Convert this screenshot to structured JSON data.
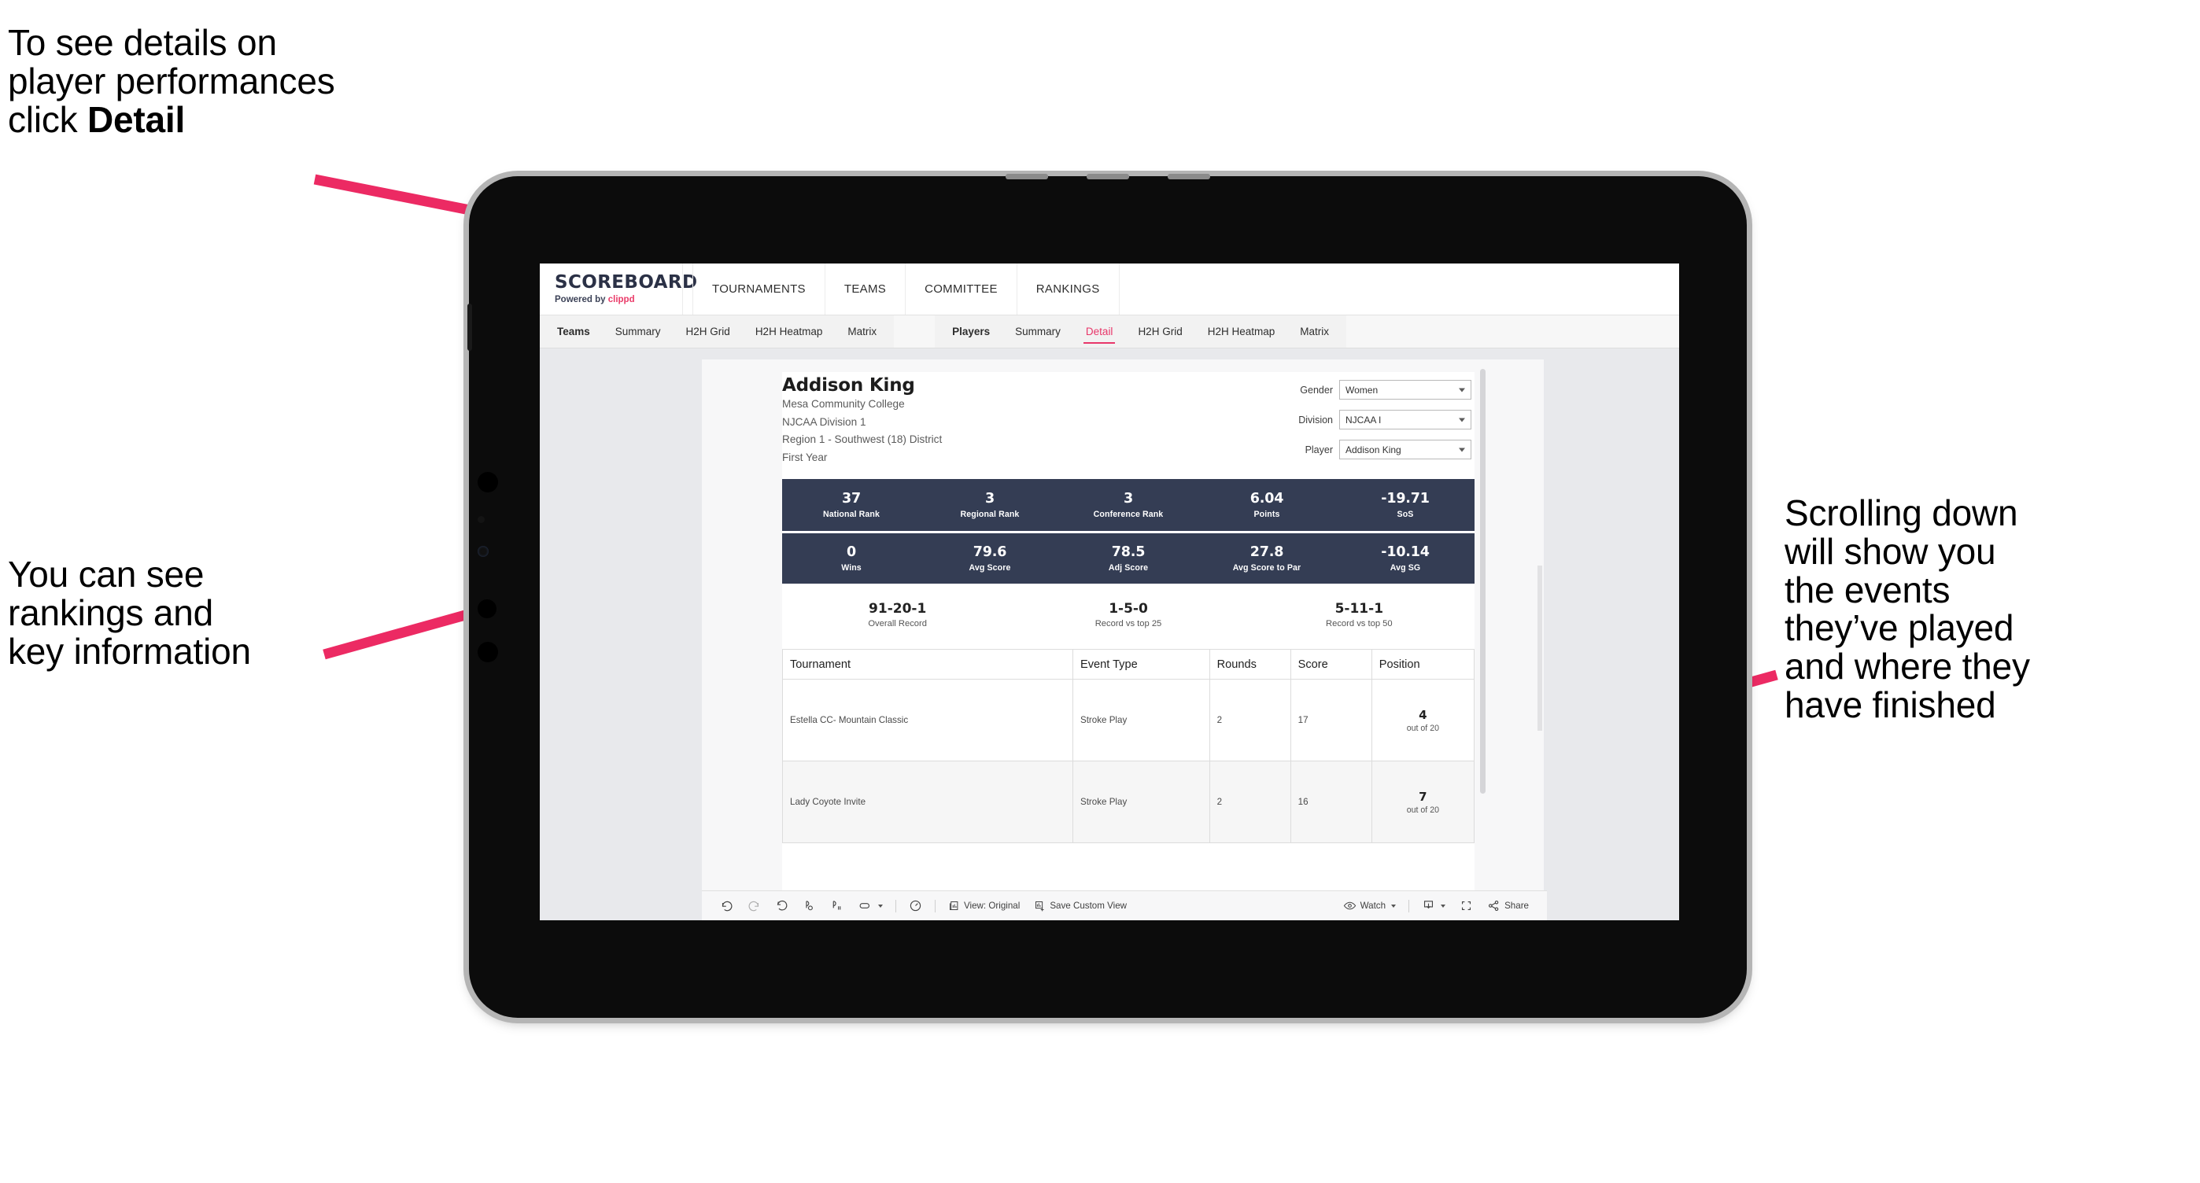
{
  "annotations": {
    "top_left": "To see details on\nplayer performances\nclick ",
    "top_left_bold": "Detail",
    "mid_left": "You can see\nrankings and\nkey information",
    "right": "Scrolling down\nwill show you\nthe events\nthey’ve played\nand where they\nhave finished"
  },
  "brand": {
    "name": "SCOREBOARD",
    "powered_prefix": "Powered by ",
    "powered_brand": "clippd",
    "accent_color": "#ea3a68"
  },
  "top_nav": [
    {
      "label": "TOURNAMENTS"
    },
    {
      "label": "TEAMS"
    },
    {
      "label": "COMMITTEE"
    },
    {
      "label": "RANKINGS"
    }
  ],
  "tabs": {
    "group_teams": [
      {
        "label": "Teams",
        "active": false
      },
      {
        "label": "Summary",
        "active": false
      },
      {
        "label": "H2H Grid",
        "active": false
      },
      {
        "label": "H2H Heatmap",
        "active": false
      },
      {
        "label": "Matrix",
        "active": false
      }
    ],
    "group_players": [
      {
        "label": "Players",
        "active": false
      },
      {
        "label": "Summary",
        "active": false
      },
      {
        "label": "Detail",
        "active": true
      },
      {
        "label": "H2H Grid",
        "active": false
      },
      {
        "label": "H2H Heatmap",
        "active": false
      },
      {
        "label": "Matrix",
        "active": false
      }
    ]
  },
  "player": {
    "name": "Addison King",
    "school": "Mesa Community College",
    "division": "NJCAA Division 1",
    "region": "Region 1 - Southwest (18) District",
    "year": "First Year"
  },
  "filters": [
    {
      "label": "Gender",
      "value": "Women"
    },
    {
      "label": "Division",
      "value": "NJCAA I"
    },
    {
      "label": "Player",
      "value": "Addison King"
    }
  ],
  "stats_band_1": [
    {
      "value": "37",
      "label": "National Rank"
    },
    {
      "value": "3",
      "label": "Regional Rank"
    },
    {
      "value": "3",
      "label": "Conference Rank"
    },
    {
      "value": "6.04",
      "label": "Points"
    },
    {
      "value": "-19.71",
      "label": "SoS"
    }
  ],
  "stats_band_2": [
    {
      "value": "0",
      "label": "Wins"
    },
    {
      "value": "79.6",
      "label": "Avg Score"
    },
    {
      "value": "78.5",
      "label": "Adj Score"
    },
    {
      "value": "27.8",
      "label": "Avg Score to Par"
    },
    {
      "value": "-10.14",
      "label": "Avg SG"
    }
  ],
  "records": [
    {
      "value": "91-20-1",
      "label": "Overall Record"
    },
    {
      "value": "1-5-0",
      "label": "Record vs top 25"
    },
    {
      "value": "5-11-1",
      "label": "Record vs top 50"
    }
  ],
  "table": {
    "headers": [
      "Tournament",
      "Event Type",
      "Rounds",
      "Score",
      "Position"
    ],
    "rows": [
      {
        "tournament": "Estella CC- Mountain Classic",
        "event_type": "Stroke Play",
        "rounds": "2",
        "score": "17",
        "position": "4",
        "position_of": "out of 20"
      },
      {
        "tournament": "Lady Coyote Invite",
        "event_type": "Stroke Play",
        "rounds": "2",
        "score": "16",
        "position": "7",
        "position_of": "out of 20"
      }
    ]
  },
  "toolbar": {
    "undo": "undo-icon",
    "redo": "redo-icon",
    "revert": "revert-icon",
    "refresh": "refresh-data-icon",
    "pause": "pause-auto-update-icon",
    "highlight": "highlight-icon",
    "slideshow": "device-preview-icon",
    "view_label": "View: Original",
    "save_label": "Save Custom View",
    "watch_label": "Watch",
    "download_label": "download-icon",
    "fullscreen_label": "fullscreen-icon",
    "share_label": "Share"
  },
  "colors": {
    "band": "#343d54",
    "accent": "#e8376a",
    "screen_bg": "#e8e9ec",
    "arrow": "#ec2a63"
  }
}
